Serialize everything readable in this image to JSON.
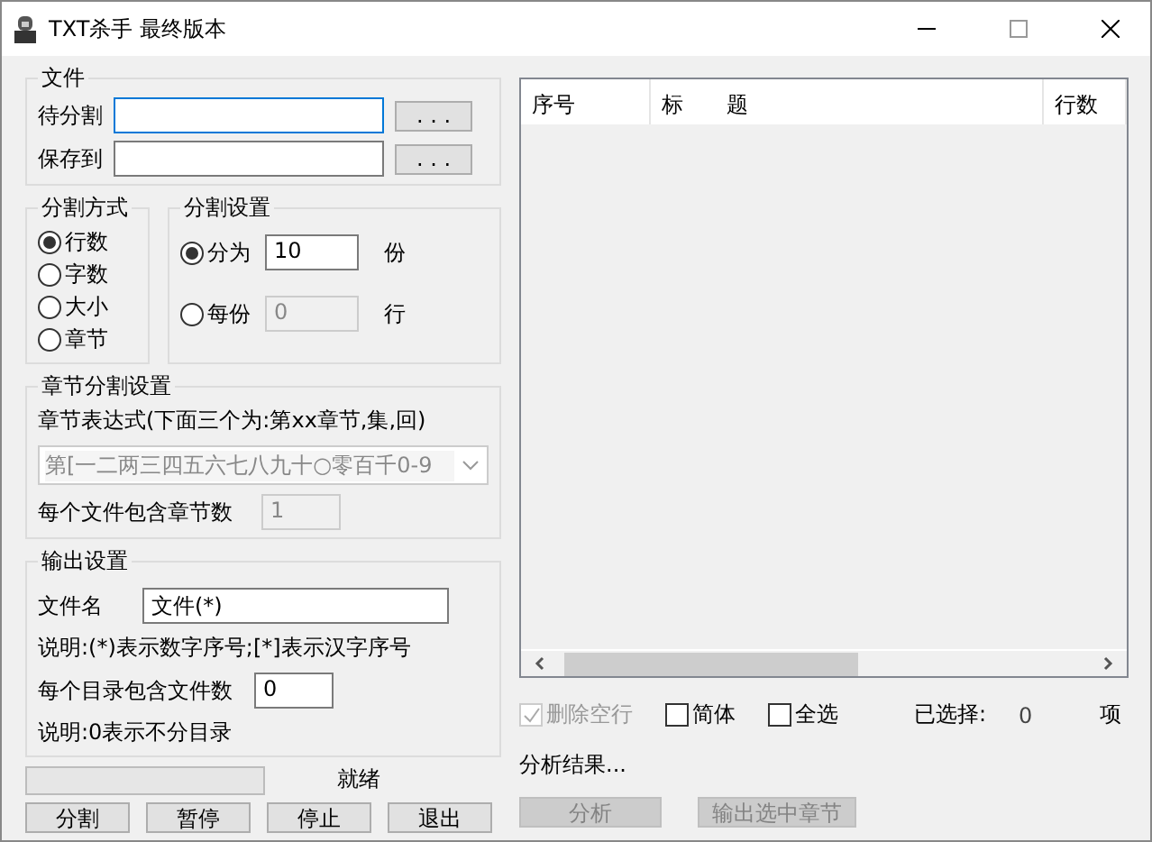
{
  "window": {
    "title": "TXT杀手 最终版本"
  },
  "file_group": {
    "title": "文件",
    "fields": [
      {
        "label": "待分割",
        "browse": ". . .",
        "focused": true
      },
      {
        "label": "保存到",
        "browse": ". . .",
        "focused": false
      }
    ]
  },
  "split_mode": {
    "title": "分割方式",
    "options": [
      {
        "label": "行数",
        "selected": true
      },
      {
        "label": "字数",
        "selected": false
      },
      {
        "label": "大小",
        "selected": false
      },
      {
        "label": "章节",
        "selected": false
      }
    ]
  },
  "split_settings": {
    "title": "分割设置",
    "options": [
      {
        "label": "分为",
        "selected": true,
        "value": "10",
        "unit": "份",
        "disabled": false
      },
      {
        "label": "每份",
        "selected": false,
        "value": "0",
        "unit": "行",
        "disabled": true
      }
    ]
  },
  "chapter": {
    "title": "章节分割设置",
    "expression_label": "章节表达式(下面三个为:第xx章节,集,回)",
    "expression": "第[一二两三四五六七八九十○零百千0-9",
    "chapters_label": "每个文件包含章节数",
    "chapters_value": "1",
    "disabled": true
  },
  "output": {
    "title": "输出设置",
    "filename_label": "文件名",
    "filename": "文件(*)",
    "note1": "说明:(*)表示数字序号;[*]表示汉字序号",
    "per_dir_label": "每个目录包含文件数",
    "per_dir": "0",
    "note2": "说明:0表示不分目录"
  },
  "progress": {
    "level": 0,
    "status": "就绪"
  },
  "actions": [
    {
      "label": "分割",
      "disabled": false
    },
    {
      "label": "暂停",
      "disabled": false
    },
    {
      "label": "停止",
      "disabled": false
    },
    {
      "label": "退出",
      "disabled": false
    }
  ],
  "list": {
    "columns": [
      "序号",
      "标　　题",
      "行数"
    ]
  },
  "options": [
    {
      "label": "删除空行",
      "checked": true,
      "disabled": true
    },
    {
      "label": "简体",
      "checked": false,
      "disabled": false
    },
    {
      "label": "全选",
      "checked": false,
      "disabled": false
    }
  ],
  "selected_count": {
    "label": "已选择:",
    "value": "0",
    "unit": "项"
  },
  "analysis": {
    "label": "分析结果..."
  },
  "right_actions": [
    {
      "label": "分析",
      "disabled": true
    },
    {
      "label": "输出选中章节",
      "disabled": true
    }
  ]
}
